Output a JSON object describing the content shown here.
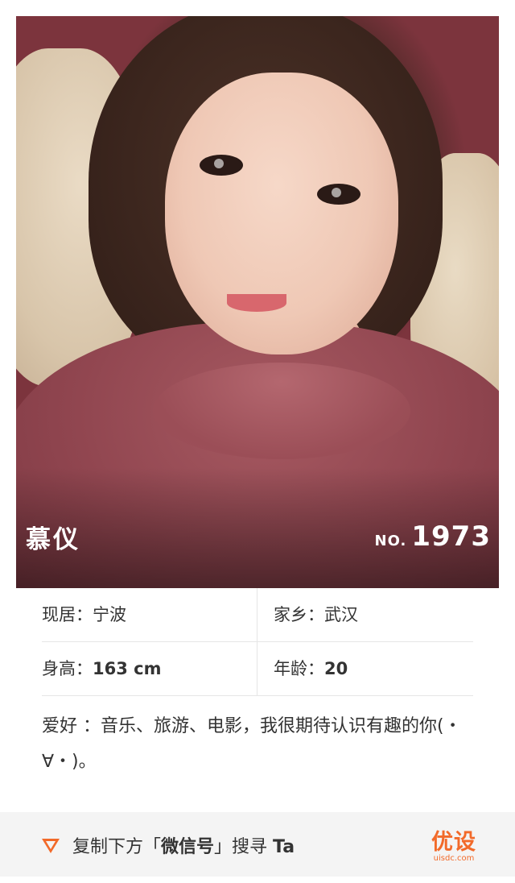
{
  "profile": {
    "name": "慕仪",
    "number_prefix": "NO.",
    "number": "1973"
  },
  "info": {
    "residence_label": "现居：",
    "residence_value": "宁波",
    "hometown_label": "家乡：",
    "hometown_value": "武汉",
    "height_label": "身高：",
    "height_value": "163 cm",
    "age_label": "年龄：",
    "age_value": "20",
    "hobby_text": "爱好 ：音乐、旅游、电影，我很期待认识有趣的你(・∀・)。"
  },
  "footer": {
    "text_prefix": "复制下方「",
    "text_bold": "微信号",
    "text_middle": "」搜寻 ",
    "text_suffix": "Ta",
    "logo_cn": "优设",
    "logo_en": "uisdc.com",
    "accent_color": "#f26a2a"
  }
}
